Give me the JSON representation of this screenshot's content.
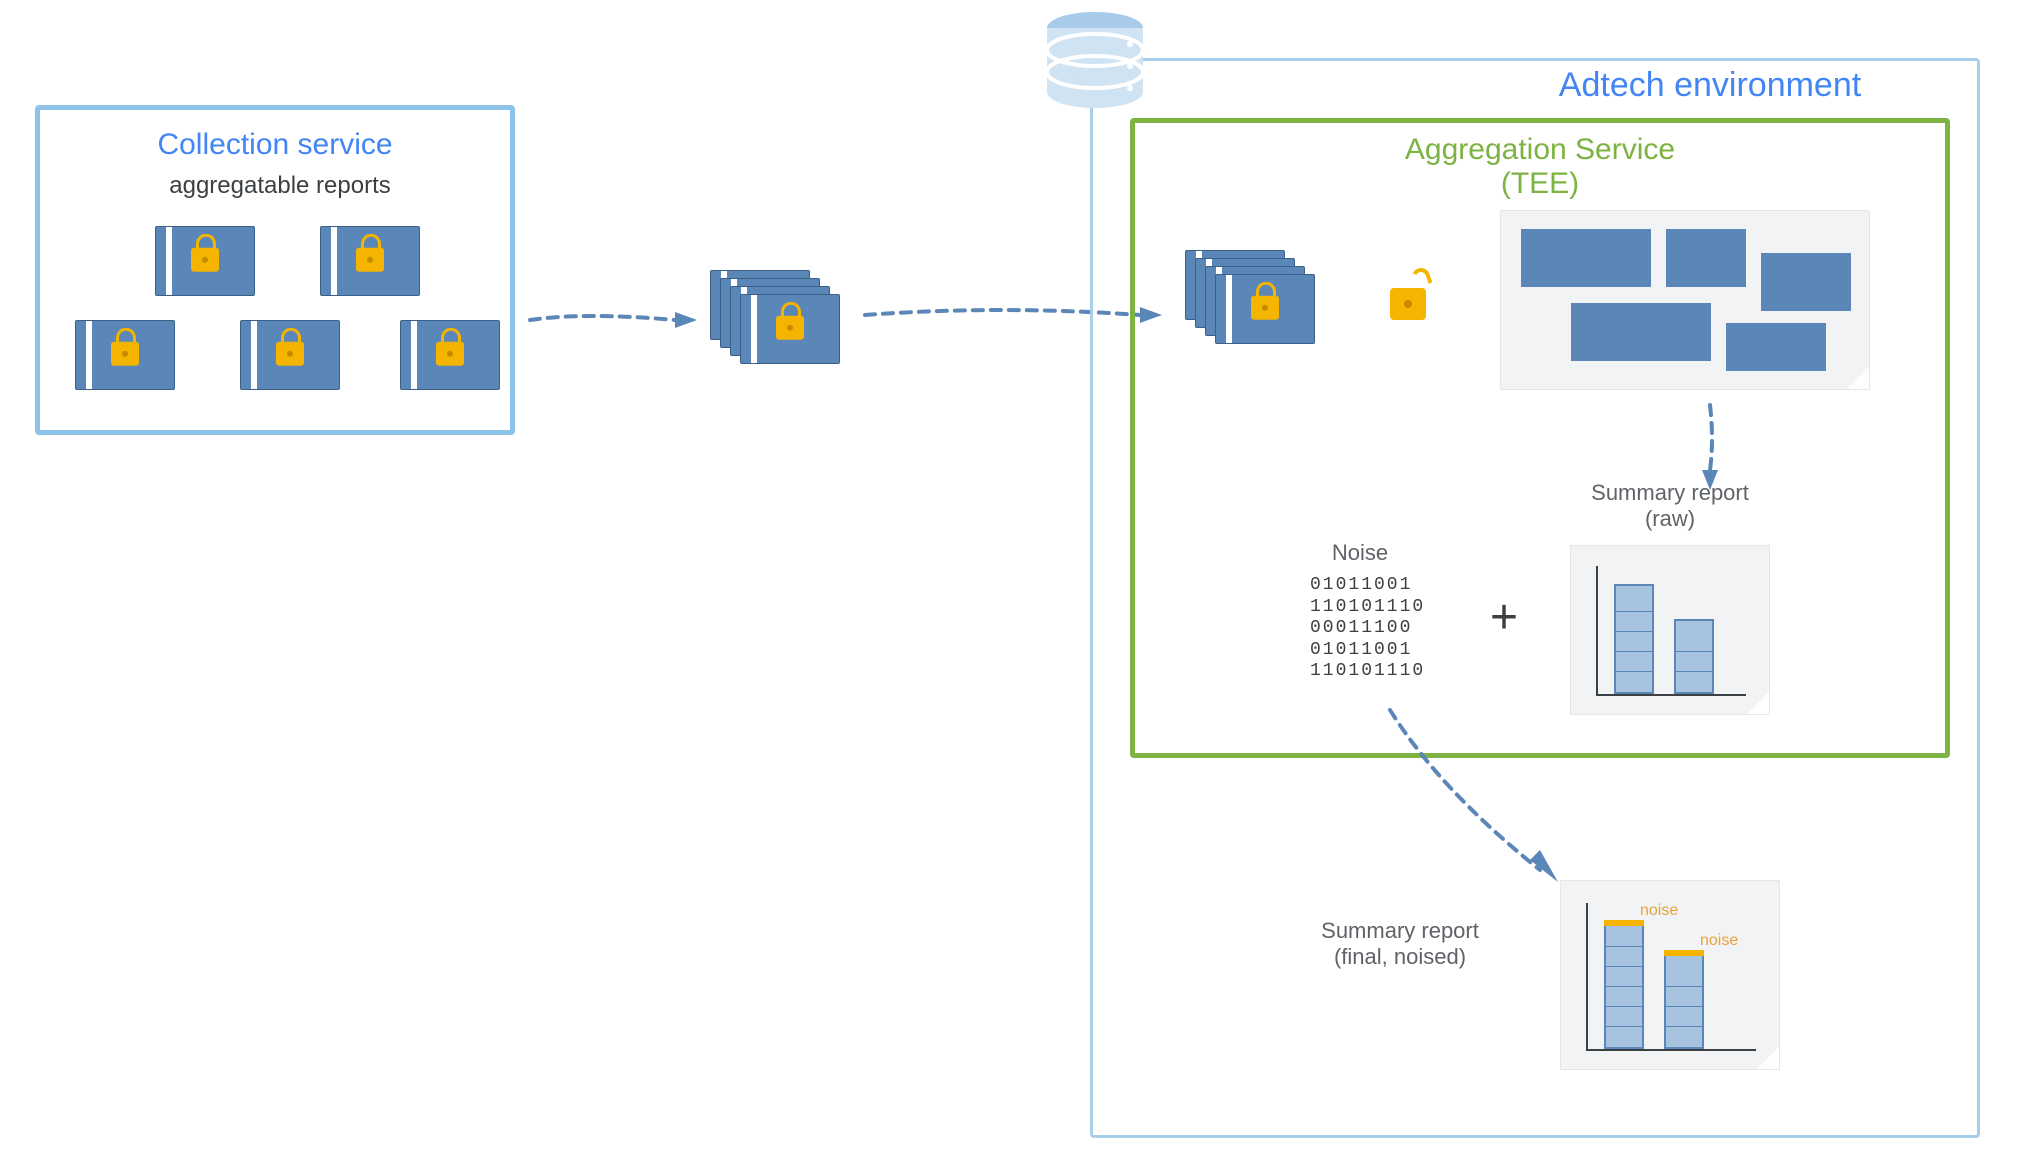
{
  "collection_box": {
    "title": "Collection service",
    "subtitle": "aggregatable reports",
    "color": "#8DC3E8"
  },
  "adtech_box": {
    "title": "Adtech environment",
    "color": "#8DC3E8"
  },
  "aggregation_box": {
    "title_line1": "Aggregation Service",
    "title_line2": "(TEE)",
    "color": "#7CB342"
  },
  "labels": {
    "noise": "Noise",
    "plus": "+",
    "summary_raw_line1": "Summary report",
    "summary_raw_line2": "(raw)",
    "summary_final_line1": "Summary report",
    "summary_final_line2": "(final, noised)",
    "noise_tag": "noise"
  },
  "noise_bits": [
    "01011001",
    "110101110",
    "00011100",
    "01011001",
    "110101110"
  ],
  "icons": {
    "folder": "locked-folder-icon",
    "stack": "locked-folder-stack-icon",
    "unlock": "unlock-icon",
    "database": "database-icon",
    "document": "document-icon",
    "barchart": "bar-chart-icon"
  }
}
